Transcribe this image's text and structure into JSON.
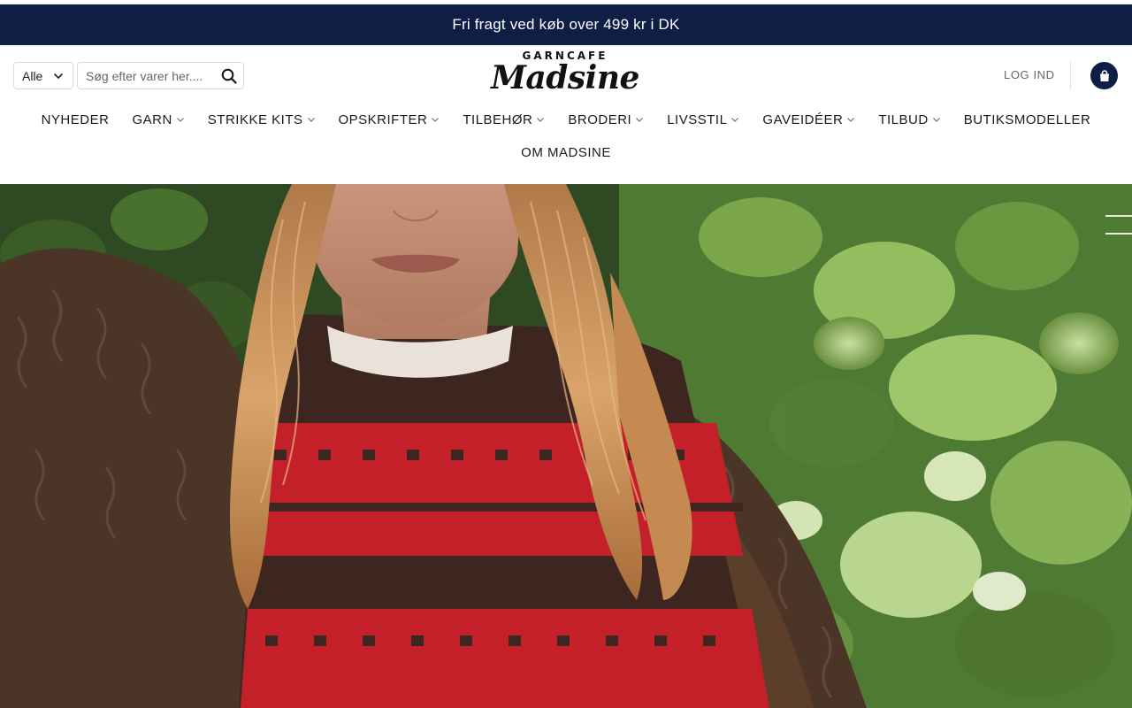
{
  "promo": {
    "text": "Fri fragt ved køb over 499 kr i DK"
  },
  "search": {
    "category_value": "Alle",
    "placeholder": "Søg efter varer her...."
  },
  "logo": {
    "top": "GARNCAFE",
    "main": "Madsine"
  },
  "account": {
    "login_label": "LOG IND"
  },
  "nav": {
    "row1": [
      {
        "label": "NYHEDER",
        "has_dropdown": false
      },
      {
        "label": "GARN",
        "has_dropdown": true
      },
      {
        "label": "STRIKKE KITS",
        "has_dropdown": true
      },
      {
        "label": "OPSKRIFTER",
        "has_dropdown": true
      },
      {
        "label": "TILBEHØR",
        "has_dropdown": true
      },
      {
        "label": "BRODERI",
        "has_dropdown": true
      },
      {
        "label": "LIVSSTIL",
        "has_dropdown": true
      },
      {
        "label": "GAVEIDÉER",
        "has_dropdown": true
      },
      {
        "label": "TILBUD",
        "has_dropdown": true
      },
      {
        "label": "BUTIKSMODELLER",
        "has_dropdown": false
      }
    ],
    "row2": [
      {
        "label": "OM MADSINE",
        "has_dropdown": false
      }
    ]
  },
  "colors": {
    "brand_navy": "#0f1e45",
    "text_dark": "#1a1a1a",
    "muted": "#666666"
  },
  "icons": {
    "category_chevron": "chevron-down-icon",
    "search": "search-icon",
    "cart": "shopping-bag-icon",
    "nav_chevron": "chevron-down-icon"
  }
}
